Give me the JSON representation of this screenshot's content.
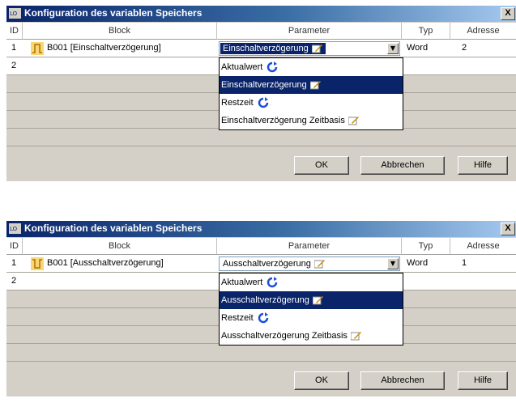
{
  "dialogs": [
    {
      "title": "Konfiguration des variablen Speichers",
      "close_label": "X",
      "columns": [
        "ID",
        "Block",
        "Parameter",
        "Typ",
        "Adresse"
      ],
      "rows": [
        {
          "id": "1",
          "block": "B001 [Einschaltverzögerung]",
          "parameter": "Einschaltverzögerung",
          "typ": "Word",
          "adresse": "2"
        },
        {
          "id": "2"
        }
      ],
      "dropdown_options": [
        {
          "label": "Aktualwert",
          "icon": "refresh-icon"
        },
        {
          "label": "Einschaltverzögerung",
          "icon": "edit-icon",
          "selected": true
        },
        {
          "label": "Restzeit",
          "icon": "refresh-icon"
        },
        {
          "label": "Einschaltverzögerung Zeitbasis",
          "icon": "edit-icon"
        }
      ],
      "buttons": {
        "ok": "OK",
        "cancel": "Abbrechen",
        "help": "Hilfe"
      }
    },
    {
      "title": "Konfiguration des variablen Speichers",
      "close_label": "X",
      "columns": [
        "ID",
        "Block",
        "Parameter",
        "Typ",
        "Adresse"
      ],
      "rows": [
        {
          "id": "1",
          "block": "B001 [Ausschaltverzögerung]",
          "parameter": "Ausschaltverzögerung",
          "typ": "Word",
          "adresse": "1"
        },
        {
          "id": "2"
        }
      ],
      "dropdown_options": [
        {
          "label": "Aktualwert",
          "icon": "refresh-icon"
        },
        {
          "label": "Ausschaltverzögerung",
          "icon": "edit-icon",
          "selected": true
        },
        {
          "label": "Restzeit",
          "icon": "refresh-icon"
        },
        {
          "label": "Ausschaltverzögerung Zeitbasis",
          "icon": "edit-icon"
        }
      ],
      "buttons": {
        "ok": "OK",
        "cancel": "Abbrechen",
        "help": "Hilfe"
      }
    }
  ],
  "colors": {
    "title_gradient_start": "#0a246a",
    "selection": "#0a246a",
    "block_icon": "#e8a800"
  }
}
